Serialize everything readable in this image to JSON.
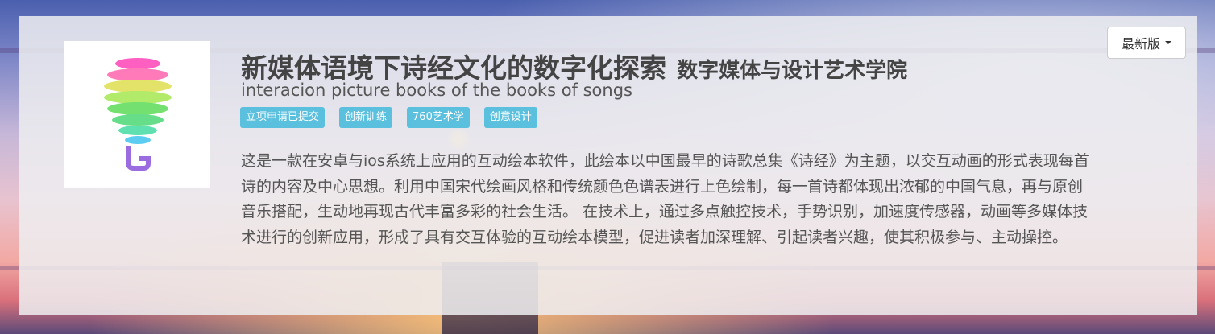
{
  "project": {
    "title": "新媒体语境下诗经文化的数字化探索",
    "college": "数字媒体与设计艺术学院",
    "subtitle": "interacion picture books of the books of songs",
    "tags": [
      "立项申请已提交",
      "创新训练",
      "760艺术学",
      "创意设计"
    ],
    "description": "这是一款在安卓与ios系统上应用的互动绘本软件，此绘本以中国最早的诗歌总集《诗经》为主题，以交互动画的形式表现每首诗的内容及中心思想。利用中国宋代绘画风格和传统颜色色谱表进行上色绘制，每一首诗都体现出浓郁的中国气息，再与原创音乐搭配，生动地再现古代丰富多彩的社会生活。 在技术上，通过多点触控技术，手势识别，加速度传感器，动画等多媒体技术进行的创新应用，形成了具有交互体验的互动绘本模型，促进读者加深理解、引起读者兴趣，使其积极参与、主动操控。"
  },
  "version_dropdown": {
    "label": "最新版",
    "icon": "caret-down-icon"
  },
  "logo": {
    "icon": "spiral-balloon-logo"
  },
  "colors": {
    "tag_bg": "#5bc0de",
    "panel_bg": "#eeeef0",
    "text": "#555555"
  }
}
